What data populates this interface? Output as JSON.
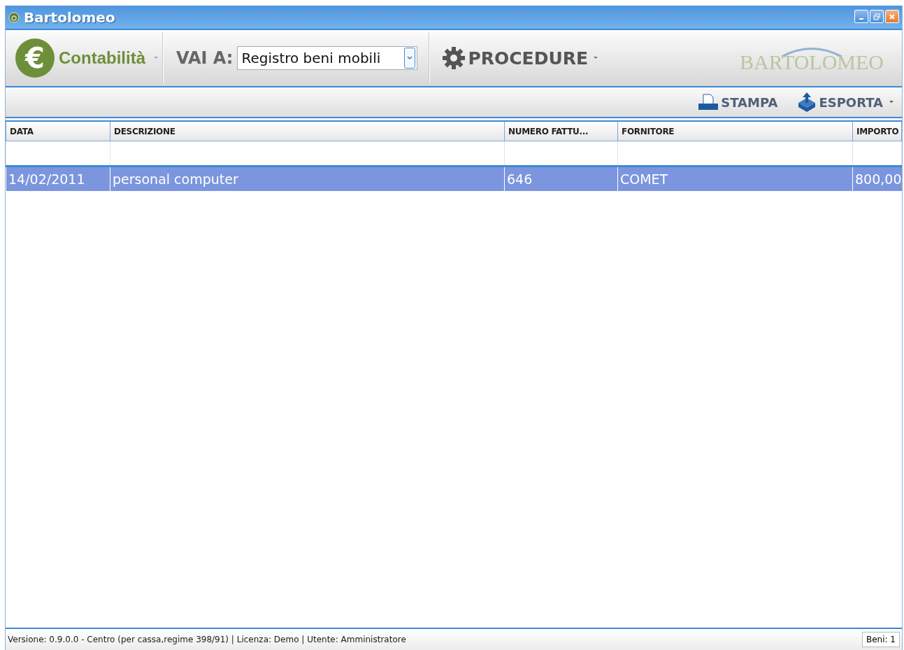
{
  "window": {
    "title": "Bartolomeo"
  },
  "toolbar": {
    "module": {
      "symbol": "€",
      "label": "Contabilità"
    },
    "goto_label": "VAI A:",
    "goto_select": {
      "value": "Registro beni mobili"
    },
    "procedures": "PROCEDURE",
    "logo_text": "BARTOLOMEO"
  },
  "actions": [
    {
      "kind": "print",
      "label": "STAMPA",
      "dropdown": false
    },
    {
      "kind": "export",
      "label": "ESPORTA",
      "dropdown": true
    }
  ],
  "table": {
    "columns": [
      {
        "label": "DATA",
        "kind": "text"
      },
      {
        "label": "DESCRIZIONE",
        "kind": "text"
      },
      {
        "label": "NUMERO FATTU...",
        "kind": "text"
      },
      {
        "label": "FORNITORE",
        "kind": "text"
      },
      {
        "label": "IMPORTO",
        "kind": "amount"
      }
    ],
    "rows": [
      {
        "selected": true,
        "cells": [
          "14/02/2011",
          "personal computer",
          "646",
          "COMET",
          "800,00"
        ]
      }
    ]
  },
  "status_bar": {
    "text": "Versione: 0.9.0.0 - Centro (per cassa,regime 398/91) | Licenza: Demo | Utente: Amministratore",
    "count": "Beni: 1"
  }
}
